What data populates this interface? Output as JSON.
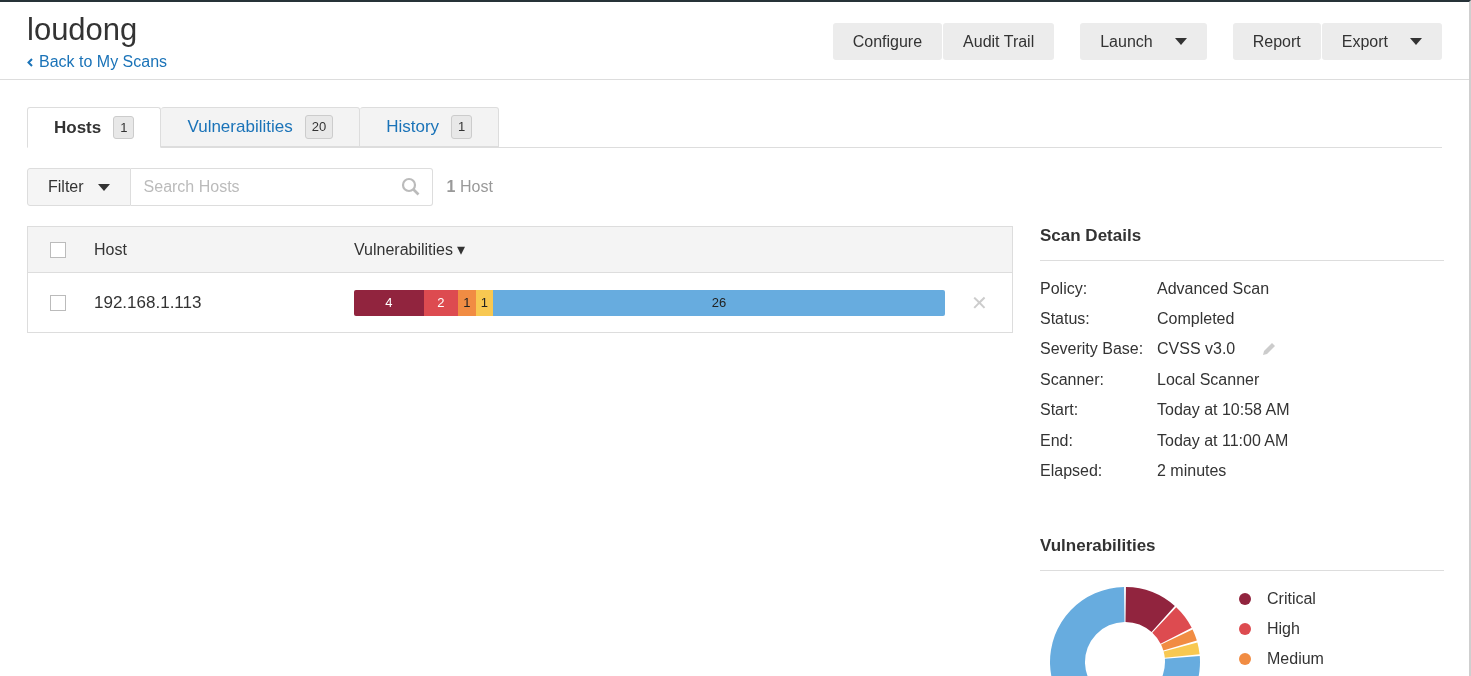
{
  "header": {
    "title": "loudong",
    "back_link": "Back to My Scans",
    "button_groups": [
      [
        {
          "label": "Configure",
          "kind": "plain"
        },
        {
          "label": "Audit Trail",
          "kind": "plain"
        }
      ],
      [
        {
          "label": "Launch",
          "kind": "dropdown"
        }
      ],
      [
        {
          "label": "Report",
          "kind": "plain"
        },
        {
          "label": "Export",
          "kind": "dropdown"
        }
      ]
    ]
  },
  "tabs": [
    {
      "label": "Hosts",
      "count": "1",
      "selected": true
    },
    {
      "label": "Vulnerabilities",
      "count": "20",
      "selected": false
    },
    {
      "label": "History",
      "count": "1",
      "selected": false
    }
  ],
  "filter": {
    "label": "Filter",
    "placeholder": "Search Hosts",
    "result_count": "1",
    "result_label": "Host"
  },
  "table": {
    "columns": [
      "Host",
      "Vulnerabilities ▾"
    ],
    "rows": [
      {
        "checked": false,
        "host": "192.168.1.113",
        "segments": [
          {
            "count": "4",
            "color": "#91243e"
          },
          {
            "count": "2",
            "color": "#dd4b50"
          },
          {
            "count": "1",
            "color": "#f18c43"
          },
          {
            "count": "1",
            "color": "#f8c851"
          },
          {
            "count": "26",
            "color": "#67acdf"
          }
        ],
        "remove": "✕"
      }
    ],
    "header_checked": false
  },
  "scan_details": {
    "title": "Scan Details",
    "rows": [
      {
        "label": "Policy:",
        "value": "Advanced Scan",
        "editable": false
      },
      {
        "label": "Status:",
        "value": "Completed",
        "editable": false
      },
      {
        "label": "Severity Base:",
        "value": "CVSS v3.0",
        "editable": true
      },
      {
        "label": "Scanner:",
        "value": "Local Scanner",
        "editable": false
      },
      {
        "label": "Start:",
        "value": "Today at 10:58 AM",
        "editable": false
      },
      {
        "label": "End:",
        "value": "Today at 11:00 AM",
        "editable": false
      },
      {
        "label": "Elapsed:",
        "value": "2 minutes",
        "editable": false
      }
    ]
  },
  "vulnerabilities": {
    "title": "Vulnerabilities",
    "legend": [
      {
        "label": "Critical",
        "color": "#91243e"
      },
      {
        "label": "High",
        "color": "#dd4b50"
      },
      {
        "label": "Medium",
        "color": "#f18c43"
      }
    ]
  }
}
